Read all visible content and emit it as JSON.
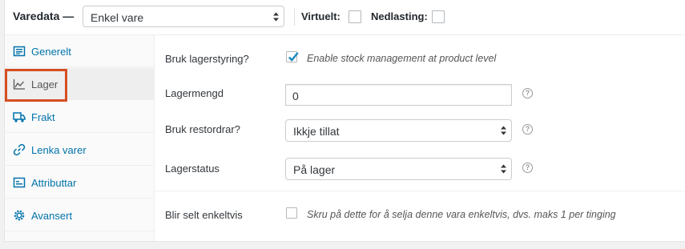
{
  "header": {
    "title": "Varedata —",
    "product_type": "Enkel vare",
    "virtual_label": "Virtuelt:",
    "download_label": "Nedlasting:"
  },
  "tabs": [
    {
      "label": "Generelt",
      "icon": "general-icon"
    },
    {
      "label": "Lager",
      "icon": "inventory-icon"
    },
    {
      "label": "Frakt",
      "icon": "shipping-icon"
    },
    {
      "label": "Lenka varer",
      "icon": "linked-products-icon"
    },
    {
      "label": "Attributtar",
      "icon": "attributes-icon"
    },
    {
      "label": "Avansert",
      "icon": "advanced-icon"
    }
  ],
  "inventory": {
    "manage_stock_label": "Bruk lagerstyring?",
    "manage_stock_desc": "Enable stock management at product level",
    "manage_stock_checked": true,
    "stock_qty_label": "Lagermengd",
    "stock_qty_value": "0",
    "backorders_label": "Bruk restordrar?",
    "backorders_value": "Ikkje tillat",
    "stock_status_label": "Lagerstatus",
    "stock_status_value": "På lager",
    "sold_individually_label": "Blir selt enkeltvis",
    "sold_individually_desc": "Skru på dette for å selja denne vara enkeltvis, dvs. maks 1 per tinging",
    "sold_individually_checked": false,
    "help_glyph": "?"
  },
  "colors": {
    "link": "#0073aa",
    "highlight": "#d54e21",
    "check": "#1e8cbe"
  }
}
